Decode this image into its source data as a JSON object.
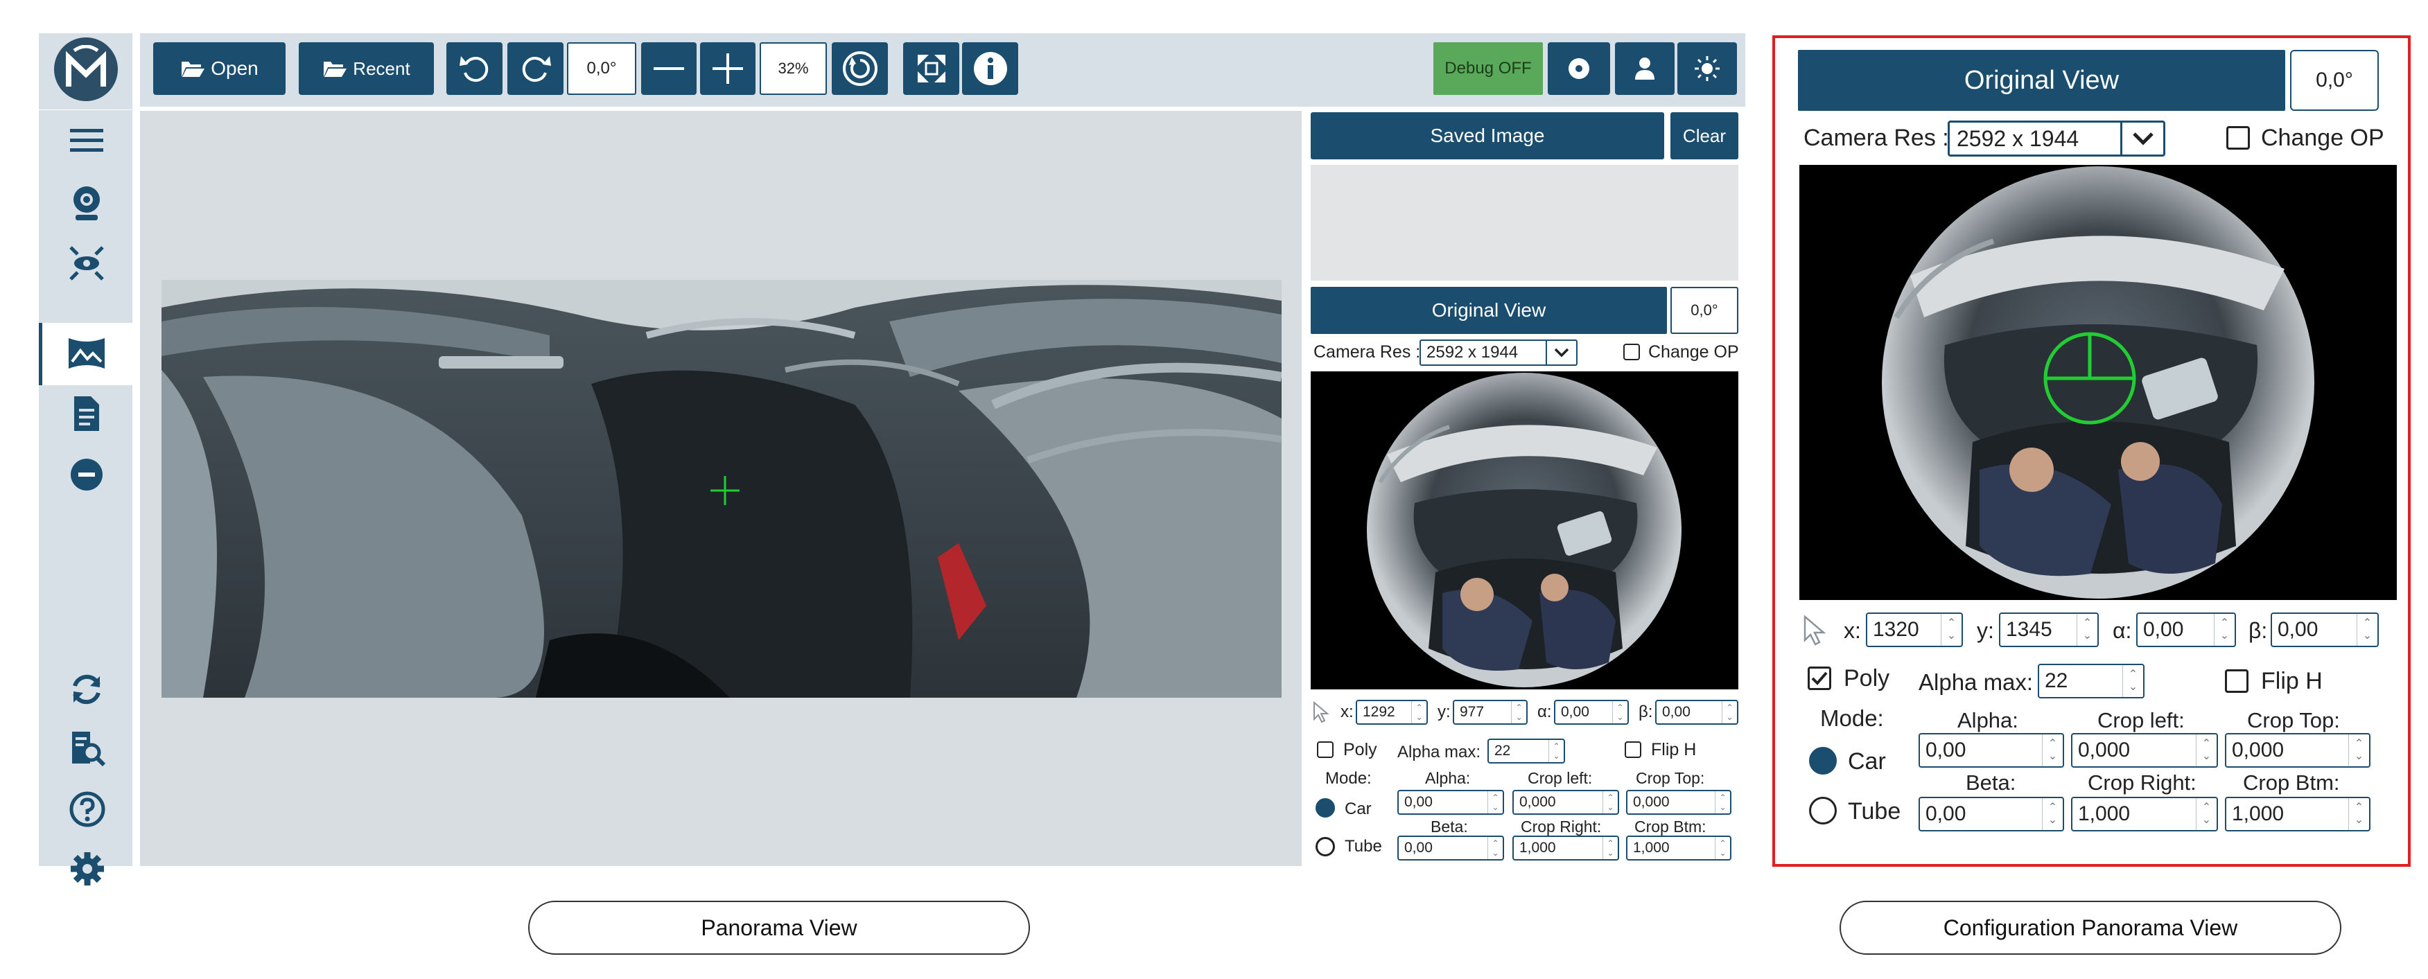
{
  "toolbar": {
    "open_label": "Open",
    "recent_label": "Recent",
    "rotation_value": "0,0°",
    "zoom_value": "32%",
    "debug_label": "Debug OFF"
  },
  "sidebar": {
    "icons": [
      "menu-icon",
      "camera-icon",
      "fisheye-icon",
      "panorama-icon",
      "document-icon",
      "minus-circle-icon",
      "refresh-icon",
      "search-doc-icon",
      "help-icon",
      "gear-icon"
    ]
  },
  "small_panel": {
    "saved_image_label": "Saved Image",
    "clear_label": "Clear",
    "original_view_label": "Original View",
    "rotation_value": "0,0°",
    "camera_res_label": "Camera Res :",
    "camera_res_value": "2592 x 1944",
    "change_op_label": "Change OP",
    "x_label": "x:",
    "x_value": "1292",
    "y_label": "y:",
    "y_value": "977",
    "alpha_label": "α:",
    "alpha_value": "0,00",
    "beta_label": "β:",
    "beta_value": "0,00",
    "poly_label": "Poly",
    "alpha_max_label": "Alpha max:",
    "alpha_max_value": "22",
    "flip_h_label": "Flip H",
    "mode_label": "Mode:",
    "car_label": "Car",
    "tube_label": "Tube",
    "alpha_field_label": "Alpha:",
    "alpha_field_value": "0,00",
    "crop_left_label": "Crop left:",
    "crop_left_value": "0,000",
    "crop_top_label": "Crop Top:",
    "crop_top_value": "0,000",
    "beta_field_label": "Beta:",
    "beta_field_value": "0,00",
    "crop_right_label": "Crop Right:",
    "crop_right_value": "1,000",
    "crop_btm_label": "Crop Btm:",
    "crop_btm_value": "1,000"
  },
  "zoom_panel": {
    "original_view_label": "Original View",
    "rotation_value": "0,0°",
    "camera_res_label": "Camera Res :",
    "camera_res_value": "2592 x 1944",
    "change_op_label": "Change OP",
    "x_label": "x:",
    "x_value": "1320",
    "y_label": "y:",
    "y_value": "1345",
    "alpha_label": "α:",
    "alpha_value": "0,00",
    "beta_label": "β:",
    "beta_value": "0,00",
    "poly_label": "Poly",
    "alpha_max_label": "Alpha max:",
    "alpha_max_value": "22",
    "flip_h_label": "Flip H",
    "mode_label": "Mode:",
    "car_label": "Car",
    "tube_label": "Tube",
    "alpha_field_label": "Alpha:",
    "alpha_field_value": "0,00",
    "crop_left_label": "Crop left:",
    "crop_left_value": "0,000",
    "crop_top_label": "Crop Top:",
    "crop_top_value": "0,000",
    "beta_field_label": "Beta:",
    "beta_field_value": "0,00",
    "crop_right_label": "Crop Right:",
    "crop_right_value": "1,000",
    "crop_btm_label": "Crop Btm:",
    "crop_btm_value": "1,000"
  },
  "captions": {
    "left": "Panorama View",
    "right": "Configuration Panorama View"
  },
  "colors": {
    "accent": "#1a4d6e",
    "panel_bg": "#d6e0e6",
    "debug_green": "#5aa85a",
    "highlight_red": "#e02020",
    "crosshair_green": "#22cc33"
  }
}
